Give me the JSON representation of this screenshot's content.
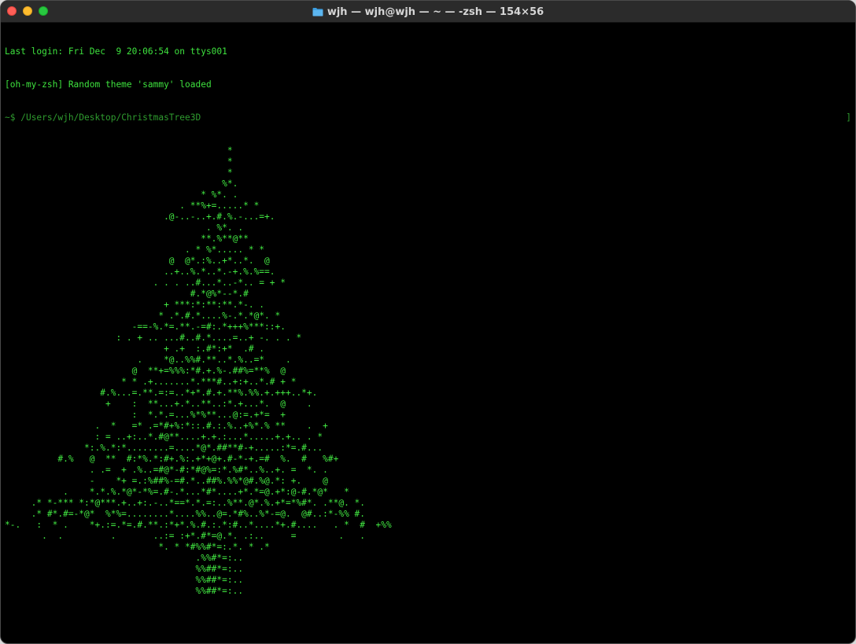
{
  "window": {
    "title": "wjh — wjh@wjh — ~ — -zsh — 154×56",
    "title_icon": "folder-icon"
  },
  "terminal": {
    "last_login": "Last login: Fri Dec  9 20:06:54 on ttys001",
    "theme_msg": "[oh-my-zsh] Random theme 'sammy' loaded",
    "prompt_prefix": "~$ ",
    "cwd": "/Users/wjh/Desktop/ChristmasTree3D",
    "right_bracket": "]",
    "tree": [
      "                                          *",
      "                                          *",
      "                                          *",
      "                                         %*.",
      "                                     * %*. .",
      "                                 . **%+=.....* *",
      "                              .@-..-..+.#.%.-...=+.",
      "                                      . %*. .",
      "                                     **.%**@**",
      "                                  . * %*..... * *",
      "                               @  @*.:%..+*..*.  @",
      "                              ..+..%.*..*.-+.%.%==.",
      "                            . . . ..#...*..-*.. = + *",
      "                                   #.*@%*--*.#",
      "                              + ***:*:**:**.*-. .",
      "                             * .*.#.*....%-.*.*@*. *",
      "                        -==-%.*=.**.-=#:.*+++%***::+.",
      "                     : . + .. ...#..#.*....=..+ -. . . *",
      "                              + .+  :.#*:+*  .# .",
      "                         .    *@..%%#.**..*.%..=*    .",
      "                        @  **+=%%%:*#.+.%-.##%=**%  @",
      "                      * * .+.......*.***#..+:+..*.# + *",
      "                  #.%...=.**.=:=..*+*.#.+.**%.%%.+.+++..*+.",
      "                   +    :  **...+.*..**..:*.+...*.  @    .",
      "                        :  *.*.=...%*%**...@:=.+*=  +",
      "                 .  *   =* .=*#+%:*::.#.:.%..+%*.% **    .  +",
      "                 : = ..+:..*.#@**....+.+.:...*.....+.+.. . *",
      "               *:.%.*:*........=....*@*.##**#-+.....:*=.#...",
      "          #.%   @  **  #:*%.*:#+.%:.+*+@+.#-*-+.=#  %.  #   %#+",
      "                . .=  + .%..=#@*-#:*#@%=:*.%#*..%..+. =  *. .",
      "                -    *+ =.:%##%-=#.*..##%.%%*@#.%@.*: +.    @",
      "           .    *.*.%.*@*-*%=.#-.*...*#*....+*.*=@.+*:@-#.*@*   *",
      "     .* *-*** *:*@***.+..+:.-..*==*.*.=:..%**.@*.%.+*=*%#*. .**@. *.",
      "     .* #*.#=-*@*  %*%=........*....%%..@=.*#%..%*-=@.  @#..:*-%% #.",
      "*-.   :  * .    *+.:=.*=.#.**.:*+*.%.#.:.*:#..*....*+.#....   . *  #  +%%",
      "       .  .         .       ..:= :+*.#*=@.*. .:..     =        .   .",
      "                             *. * *#%%#*=:.*. * .*",
      "                                    .%%#*=:..",
      "                                    %%##*=:..",
      "                                    %%##*=:..",
      "                                    %%##*=:.."
    ],
    "final_prompt": "~$"
  },
  "colors": {
    "terminal_bg": "#000000",
    "text_green": "#3ee23e",
    "path_green": "#2f9c2f",
    "titlebar_bg": "#2b2b2b",
    "close": "#ff5f57",
    "minimize": "#febc2e",
    "maximize": "#28c840"
  }
}
